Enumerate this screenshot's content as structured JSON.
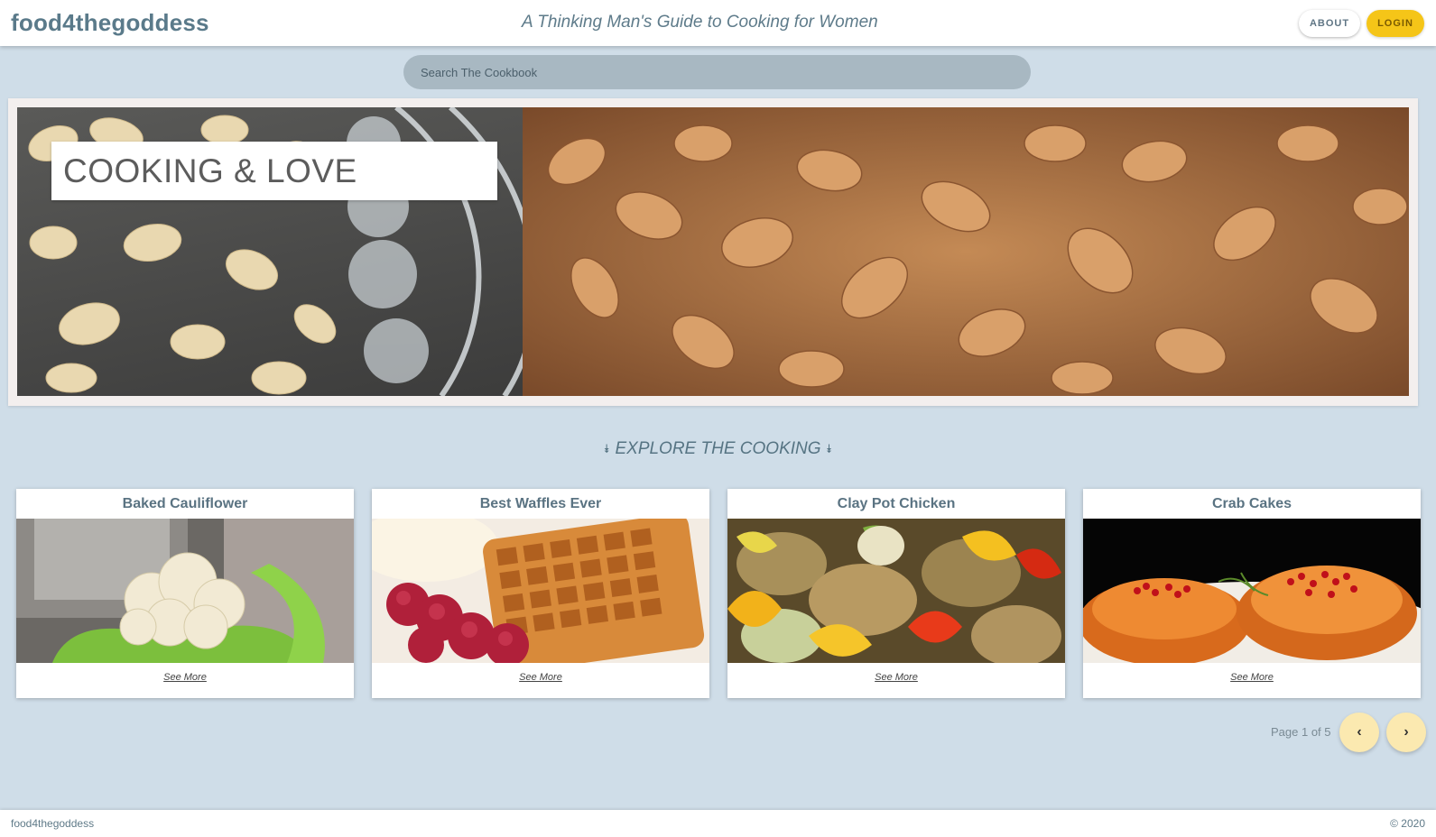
{
  "header": {
    "brand": "food4thegoddess",
    "tagline": "A Thinking Man's Guide to Cooking for Women",
    "about_label": "ABOUT",
    "login_label": "LOGIN"
  },
  "search": {
    "placeholder": "Search The Cookbook",
    "value": ""
  },
  "hero": {
    "title": "COOKING & LOVE"
  },
  "explore": {
    "heading": "EXPLORE THE COOKING",
    "chevron": "»"
  },
  "cards": [
    {
      "title": "Baked Cauliflower",
      "link": "See More"
    },
    {
      "title": "Best Waffles Ever",
      "link": "See More"
    },
    {
      "title": "Clay Pot Chicken",
      "link": "See More"
    },
    {
      "title": "Crab Cakes",
      "link": "See More"
    }
  ],
  "pagination": {
    "label": "Page 1 of 5",
    "prev_icon": "‹",
    "next_icon": "›"
  },
  "footer": {
    "brand": "food4thegoddess",
    "copyright": "© 2020"
  },
  "colors": {
    "background": "#cfdde8",
    "brand": "#5a7a8a",
    "login_accent": "#f5c518",
    "search_bg": "#a8b8c2",
    "page_button": "#fbe9b0"
  }
}
